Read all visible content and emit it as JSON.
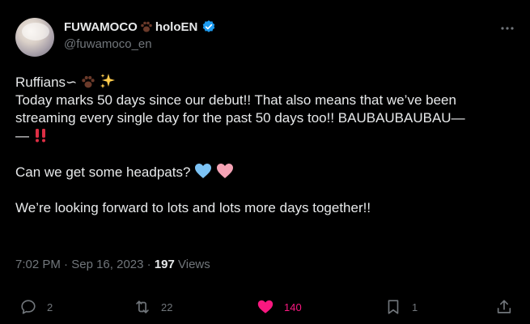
{
  "author": {
    "display_name": "FUWAMOCO",
    "display_suffix": "holoEN",
    "handle": "@fuwamoco_en",
    "verified_color": "#1d9bf0"
  },
  "tweet": {
    "line1": "Ruffians∽",
    "line2": "Today marks 50 days since our debut!! That also means that we’ve been",
    "line3": "streaming every single day for the past 50 days too!! BAUBAUBAUBAU—",
    "line4": "—",
    "line5": "Can we get some headpats?",
    "line6": "We’re looking forward to lots and lots more days together!!"
  },
  "meta": {
    "time": "7:02 PM",
    "separator": "·",
    "date": "Sep 16, 2023",
    "views_count": "197",
    "views_label": "Views"
  },
  "actions": {
    "replies": "2",
    "retweets": "22",
    "likes": "140",
    "bookmarks": "1"
  },
  "colors": {
    "background": "#000000",
    "text": "#e7e9ea",
    "secondary": "#71767b",
    "like": "#f91880",
    "blue_heart": "#7cc3f5",
    "pink_heart": "#f5a3b5"
  },
  "icons": [
    "avatar",
    "paw-icon",
    "verified-icon",
    "more-icon",
    "sparkles-icon",
    "double-exclamation-icon",
    "blue-heart-icon",
    "pink-heart-icon",
    "reply-icon",
    "retweet-icon",
    "like-icon",
    "bookmark-icon",
    "share-icon"
  ]
}
